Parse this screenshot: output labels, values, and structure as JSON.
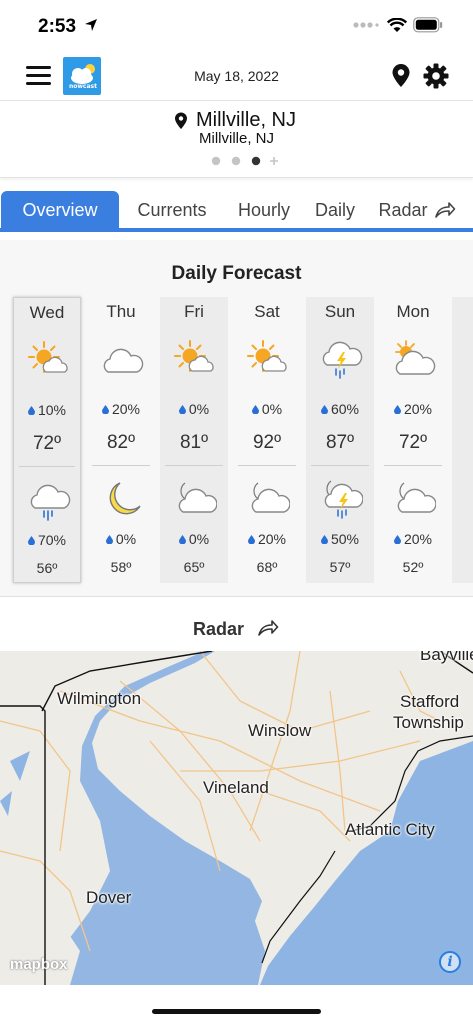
{
  "status_bar": {
    "time": "2:53"
  },
  "header": {
    "date": "May 18, 2022",
    "logo_text": "nowcast"
  },
  "location": {
    "title": "Millville, NJ",
    "subtitle": "Millville, NJ"
  },
  "tabs": [
    {
      "label": "Overview",
      "active": true
    },
    {
      "label": "Currents",
      "active": false
    },
    {
      "label": "Hourly",
      "active": false
    },
    {
      "label": "Daily",
      "active": false
    },
    {
      "label": "Radar",
      "active": false
    }
  ],
  "daily": {
    "heading": "Daily Forecast",
    "days": [
      {
        "day": "Wed",
        "day_icon": "partly-sunny-icon",
        "day_precip": "10%",
        "high": "72º",
        "night_icon": "rain-cloud-icon",
        "night_precip": "70%",
        "low": "56º"
      },
      {
        "day": "Thu",
        "day_icon": "cloud-icon",
        "day_precip": "20%",
        "high": "82º",
        "night_icon": "crescent-moon-icon",
        "night_precip": "0%",
        "low": "58º"
      },
      {
        "day": "Fri",
        "day_icon": "partly-sunny-icon",
        "day_precip": "0%",
        "high": "81º",
        "night_icon": "partly-cloudy-night-icon",
        "night_precip": "0%",
        "low": "65º"
      },
      {
        "day": "Sat",
        "day_icon": "partly-sunny-icon",
        "day_precip": "0%",
        "high": "92º",
        "night_icon": "partly-cloudy-night-icon",
        "night_precip": "20%",
        "low": "68º"
      },
      {
        "day": "Sun",
        "day_icon": "thunderstorm-icon",
        "day_precip": "60%",
        "high": "87º",
        "night_icon": "night-thunderstorm-icon",
        "night_precip": "50%",
        "low": "57º"
      },
      {
        "day": "Mon",
        "day_icon": "mostly-cloudy-icon",
        "day_precip": "20%",
        "high": "72º",
        "night_icon": "partly-cloudy-night-icon",
        "night_precip": "20%",
        "low": "52º"
      }
    ]
  },
  "radar": {
    "title": "Radar",
    "cities": [
      "Wilmington",
      "Stafford",
      "Township",
      "Winslow",
      "Vineland",
      "Atlantic City",
      "Dover",
      "Bayville"
    ],
    "attribution": "mapbox",
    "info_label": "i"
  },
  "colors": {
    "accent": "#3a7ee0",
    "sun": "#f5a623",
    "drop": "#2a6fd6",
    "water": "#8db4e2",
    "land": "#eeece7"
  }
}
